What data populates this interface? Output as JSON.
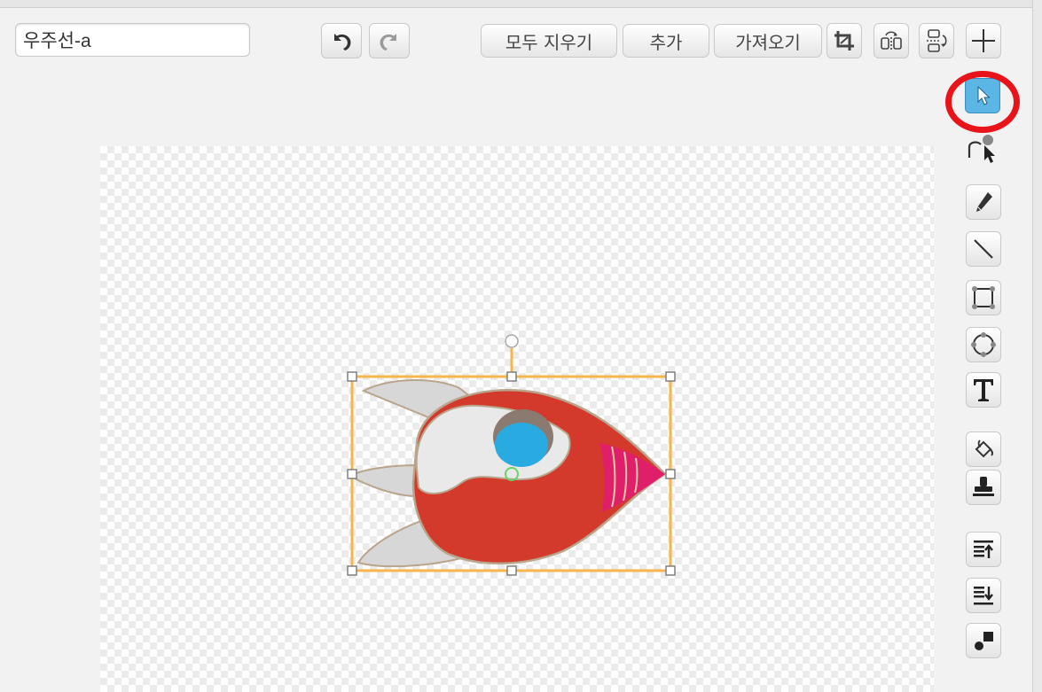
{
  "costume": {
    "name_value": "우주선-a"
  },
  "toolbar": {
    "clear_label": "모두 지우기",
    "add_label": "추가",
    "import_label": "가져오기"
  },
  "icons": {
    "undo": "undo-icon",
    "redo": "redo-icon",
    "crop": "crop-icon",
    "flip_horizontal": "flip-horizontal-icon",
    "flip_vertical": "flip-vertical-icon",
    "set_center": "crosshair-icon",
    "select": "select-arrow-icon",
    "reshape": "reshape-icon",
    "pencil": "pencil-icon",
    "line": "line-icon",
    "rectangle": "rectangle-icon",
    "ellipse": "ellipse-icon",
    "text": "text-icon",
    "fill": "paint-bucket-icon",
    "stamp": "stamp-icon",
    "front": "bring-forward-icon",
    "back": "send-backward-icon",
    "ungroup": "group-icon"
  },
  "selected_tool": "select",
  "colors": {
    "selected_tool_bg": "#5bb5e5",
    "highlight_ring": "#e8141a",
    "selection_box": "#f7b54d",
    "rocket_body": "#d33a2c",
    "rocket_window": "#29abe2",
    "rocket_stripes": "#e01f6a",
    "rocket_fins": "#d7d7d7"
  }
}
